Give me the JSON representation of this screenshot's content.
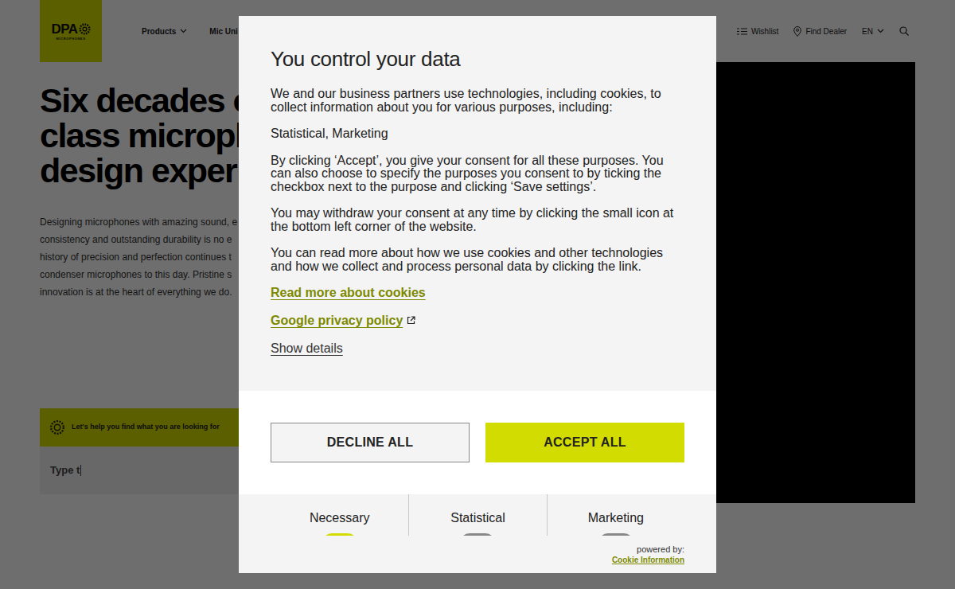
{
  "header": {
    "logo": {
      "text": "DPA",
      "subtext": "MICROPHONES"
    },
    "nav": [
      "Products",
      "Mic Uni"
    ],
    "wishlist": "Wishlist",
    "find_dealer": "Find Dealer",
    "language": "EN"
  },
  "hero": {
    "heading_lines": [
      "Six decades o",
      "class microph",
      "design exper"
    ],
    "paragraph_lines": [
      "Designing microphones with amazing sound, e",
      "consistency and outstanding durability is no e",
      "history of precision and perfection continues t",
      "condenser microphones to this day. Pristine s",
      "innovation is at the heart of everything we do."
    ]
  },
  "finder": {
    "label": "Let's help you find what you are looking for",
    "input": "Type t"
  },
  "consent": {
    "title": "You control your data",
    "intro": "We and our business partners use technologies, including cookies, to collect information about you for various purposes, including:",
    "purposes": "Statistical, Marketing",
    "paragraphs": [
      "By clicking ‘Accept’, you give your consent for all these purposes. You can also choose to specify the purposes you consent to by ticking the checkbox next to the purpose and clicking ‘Save settings’.",
      "You may withdraw your consent at any time by clicking the small icon at the bottom left corner of the website.",
      "You can read more about how we use cookies and other technologies and how we collect and process personal data by clicking the link."
    ],
    "links": [
      {
        "label": "Read more about cookies",
        "kind": "link"
      },
      {
        "label": "Google privacy policy",
        "kind": "external"
      },
      {
        "label": "Show details",
        "kind": "plain"
      }
    ],
    "buttons": [
      {
        "label": "DECLINE ALL",
        "kind": "secondary"
      },
      {
        "label": "ACCEPT ALL",
        "kind": "primary"
      }
    ],
    "categories": [
      {
        "label": "Necessary",
        "on": true
      },
      {
        "label": "Statistical",
        "on": false
      },
      {
        "label": "Marketing",
        "on": false
      }
    ],
    "powered_by": "powered by:",
    "provider": "Cookie Information"
  }
}
